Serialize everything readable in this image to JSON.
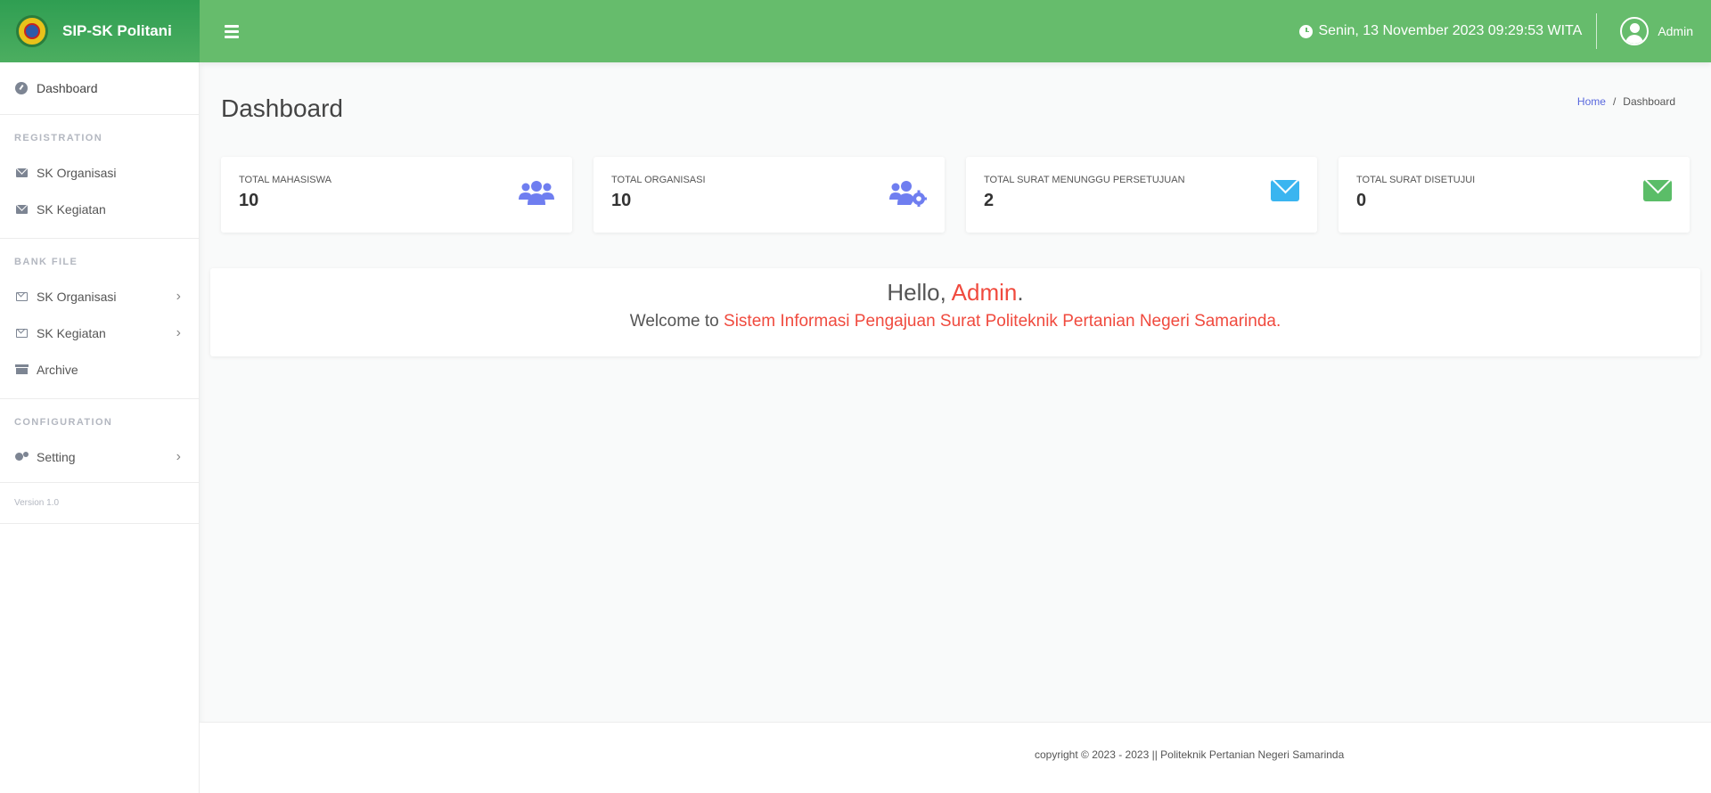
{
  "brand": {
    "name": "SIP-SK Politani"
  },
  "topbar": {
    "datetime": "Senin, 13 November 2023 09:29:53 WITA",
    "user_name": "Admin"
  },
  "sidebar": {
    "dashboard": "Dashboard",
    "sections": [
      {
        "header": "REGISTRATION",
        "items": [
          "SK Organisasi",
          "SK Kegiatan"
        ]
      },
      {
        "header": "BANK FILE",
        "items": [
          "SK Organisasi",
          "SK Kegiatan",
          "Archive"
        ]
      },
      {
        "header": "CONFIGURATION",
        "items": [
          "Setting"
        ]
      }
    ],
    "version": "Version 1.0"
  },
  "page": {
    "title": "Dashboard",
    "breadcrumb": {
      "home": "Home",
      "separator": "/",
      "current": "Dashboard"
    }
  },
  "cards": [
    {
      "label": "TOTAL MAHASISWA",
      "value": "10",
      "icon": "users-icon",
      "color": "#6f7ef0"
    },
    {
      "label": "TOTAL ORGANISASI",
      "value": "10",
      "icon": "users-cog-icon",
      "color": "#6f7ef0"
    },
    {
      "label": "TOTAL SURAT MENUNGGU PERSETUJUAN",
      "value": "2",
      "icon": "envelope-icon",
      "color": "#3ab5f0"
    },
    {
      "label": "TOTAL SURAT DISETUJUI",
      "value": "0",
      "icon": "envelope-icon",
      "color": "#5bbd68"
    }
  ],
  "welcome": {
    "hello_prefix": "Hello,",
    "hello_name": "Admin",
    "hello_suffix": ".",
    "line_prefix": "Welcome to",
    "line_highlight": "Sistem Informasi Pengajuan Surat Politeknik Pertanian Negeri Samarinda",
    "line_suffix": "."
  },
  "footer": {
    "text": "copyright © 2023 - 2023 || Politeknik Pertanian Negeri Samarinda"
  },
  "colors": {
    "topbar": "#66bc6c",
    "brand": "#2f9e52",
    "accent": "#f04a3e",
    "link": "#5867dd"
  }
}
